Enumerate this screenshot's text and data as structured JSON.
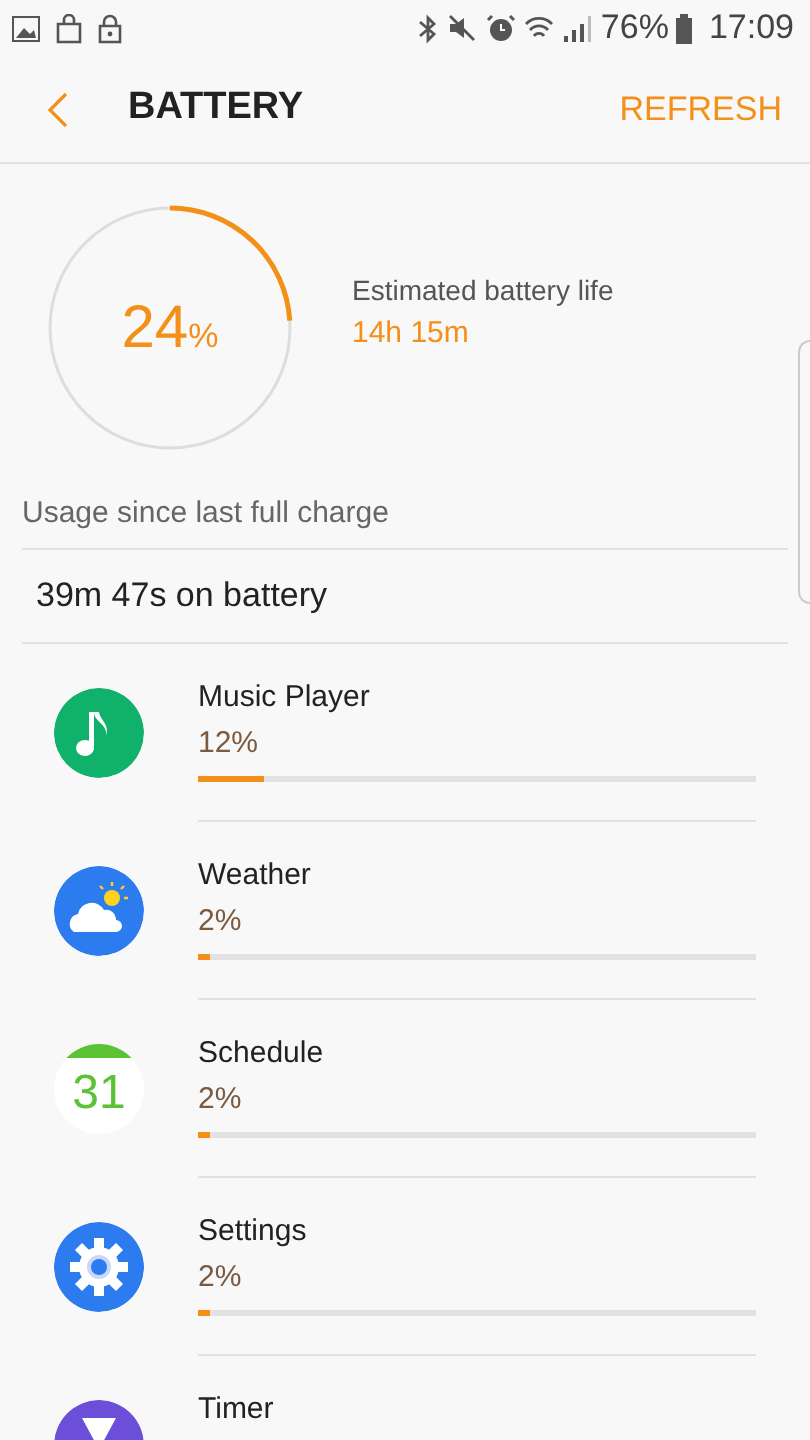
{
  "status_bar": {
    "battery": "76%",
    "time": "17:09"
  },
  "header": {
    "title": "BATTERY",
    "action": "REFRESH"
  },
  "summary": {
    "percent": "24",
    "unit": "%",
    "level": 0.24,
    "estimate_label": "Estimated battery life",
    "estimate": "14h 15m"
  },
  "usage": {
    "heading": "Usage since last full charge",
    "on_battery": "39m 47s on battery"
  },
  "apps": [
    {
      "name": "Music Player",
      "kind": "music",
      "percent": "12%",
      "level": 0.12
    },
    {
      "name": "Weather",
      "kind": "weather",
      "percent": "2%",
      "level": 0.02
    },
    {
      "name": "Schedule",
      "kind": "calendar",
      "icon_text": "31",
      "percent": "2%",
      "level": 0.02
    },
    {
      "name": "Settings",
      "kind": "gear",
      "percent": "2%",
      "level": 0.02
    },
    {
      "name": "Timer",
      "kind": "timer"
    }
  ]
}
